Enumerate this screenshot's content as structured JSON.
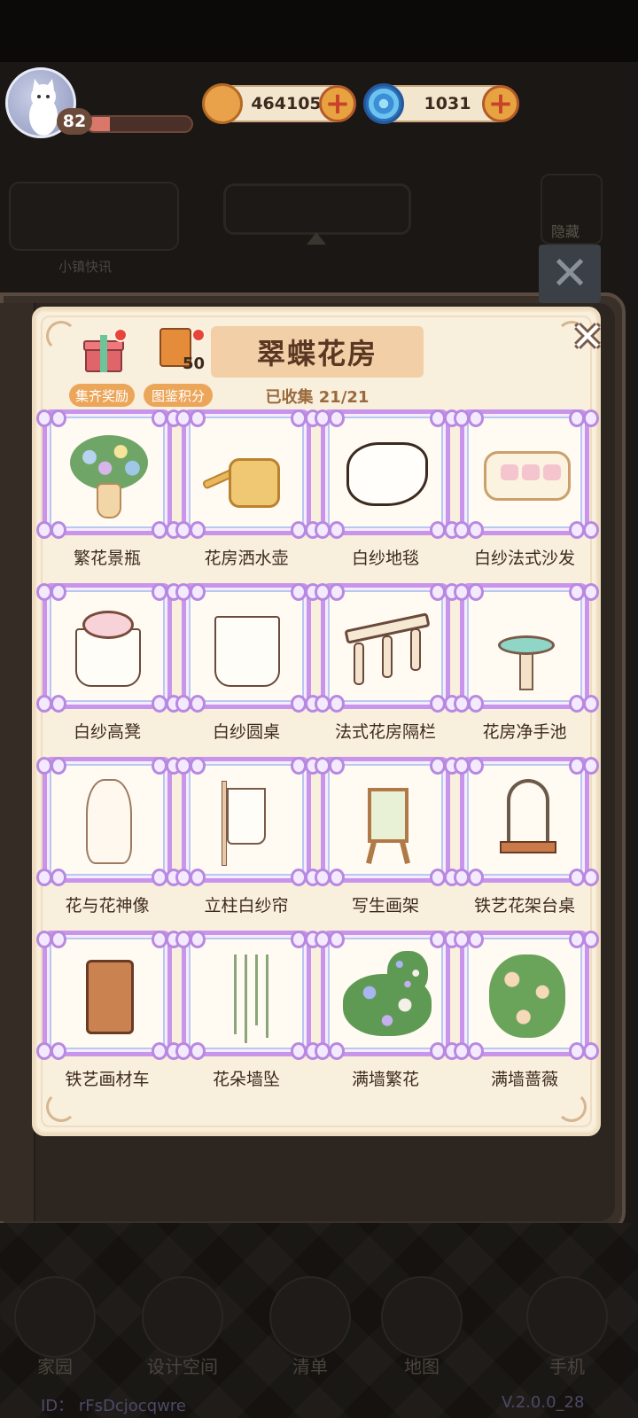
{
  "hud": {
    "level": "82",
    "exp_progress": 0.22,
    "coins": "464105",
    "gems": "1031"
  },
  "background": {
    "news_label": "小镇快讯",
    "hide_label": "隐藏",
    "nav": [
      {
        "label": "家园"
      },
      {
        "label": "设计空间"
      },
      {
        "label": "清单"
      },
      {
        "label": "地图"
      },
      {
        "label": "手机"
      }
    ],
    "user_id": "ID：  rFsDcjocqwre",
    "version": "V.2.0.0_28"
  },
  "panel": {
    "title": "翠蝶花房",
    "collected": "已收集 21/21",
    "reward_label": "集齐奖励",
    "points_label": "图鉴积分",
    "points_value": "50",
    "items": [
      {
        "name": "繁花景瓶"
      },
      {
        "name": "花房洒水壶"
      },
      {
        "name": "白纱地毯"
      },
      {
        "name": "白纱法式沙发"
      },
      {
        "name": "白纱高凳"
      },
      {
        "name": "白纱圆桌"
      },
      {
        "name": "法式花房隔栏"
      },
      {
        "name": "花房净手池"
      },
      {
        "name": "花与花神像"
      },
      {
        "name": "立柱白纱帘"
      },
      {
        "name": "写生画架"
      },
      {
        "name": "铁艺花架台桌"
      },
      {
        "name": "铁艺画材车"
      },
      {
        "name": "花朵墙坠"
      },
      {
        "name": "满墙繁花"
      },
      {
        "name": "满墙蔷薇"
      }
    ]
  },
  "colors": {
    "panel_bg": "#f9efdd",
    "frame_border": "#c895ea",
    "accent_orange": "#eca65a",
    "title_bg": "#f2cfa6"
  }
}
